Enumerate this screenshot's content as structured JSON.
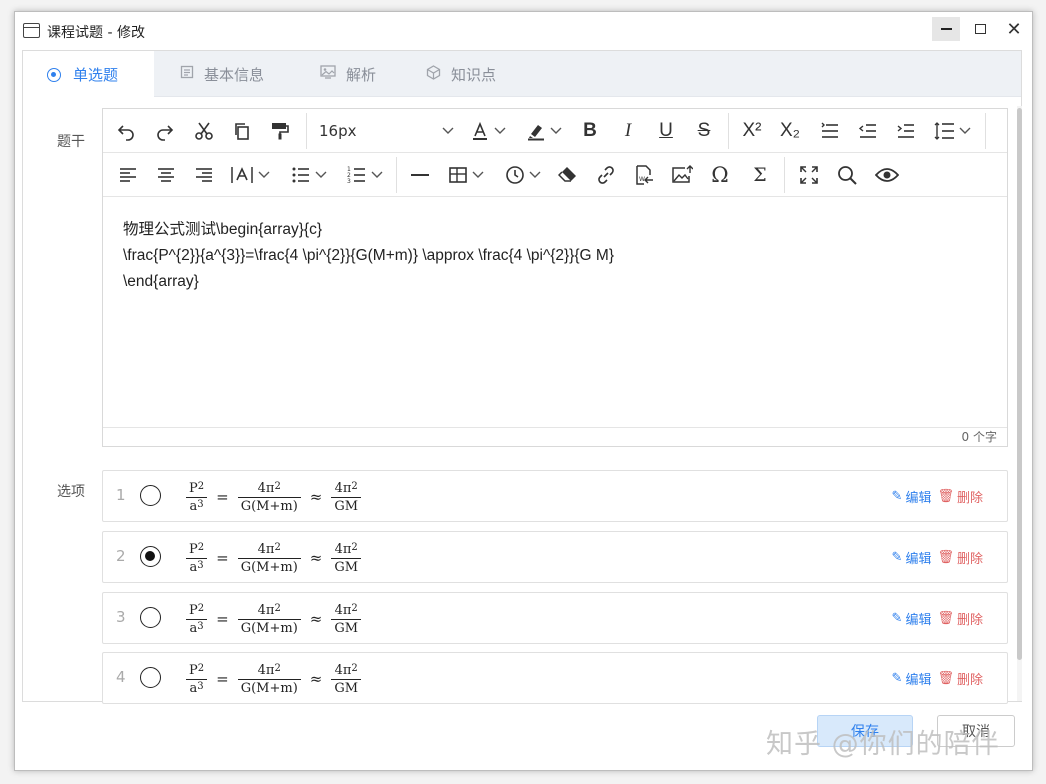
{
  "window": {
    "title": "课程试题 - 修改",
    "minimize_icon": "minimize-icon",
    "maximize_icon": "maximize-icon",
    "close_glyph": "✕"
  },
  "tabs": [
    {
      "label": "单选题",
      "icon": "radio-icon",
      "active": true
    },
    {
      "label": "基本信息",
      "icon": "document-icon",
      "active": false
    },
    {
      "label": "解析",
      "icon": "picture-icon",
      "active": false
    },
    {
      "label": "知识点",
      "icon": "cube-icon",
      "active": false
    }
  ],
  "labels": {
    "stem": "题干",
    "options": "选项"
  },
  "toolbar": {
    "font_size": "16px"
  },
  "editor": {
    "content_lines": [
      "物理公式测试\\begin{array}{c}",
      "\\frac{P^{2}}{a^{3}}=\\frac{4 \\pi^{2}}{G(M+m)} \\approx \\frac{4 \\pi^{2}}{G M}",
      "\\end{array}"
    ],
    "word_count": "0 个字"
  },
  "options": [
    {
      "num": "1",
      "checked": false,
      "edit_label": "编辑",
      "delete_label": "删除"
    },
    {
      "num": "2",
      "checked": true,
      "edit_label": "编辑",
      "delete_label": "删除"
    },
    {
      "num": "3",
      "checked": false,
      "edit_label": "编辑",
      "delete_label": "删除"
    },
    {
      "num": "4",
      "checked": false,
      "edit_label": "编辑",
      "delete_label": "删除"
    }
  ],
  "formula": {
    "lhs_num": "P",
    "lhs_num_sup": "2",
    "lhs_den": "a",
    "lhs_den_sup": "3",
    "eq": "=",
    "mid_num": "4π",
    "mid_num_sup": "2",
    "mid_den": "G(M+m)",
    "approx": "≈",
    "rhs_num": "4π",
    "rhs_num_sup": "2",
    "rhs_den": "GM"
  },
  "footer": {
    "save_label": "保存",
    "cancel_label": "取消"
  },
  "watermark": "知乎 @你们的陪伴",
  "colors": {
    "accent": "#2f80ed",
    "danger": "#e06363"
  }
}
